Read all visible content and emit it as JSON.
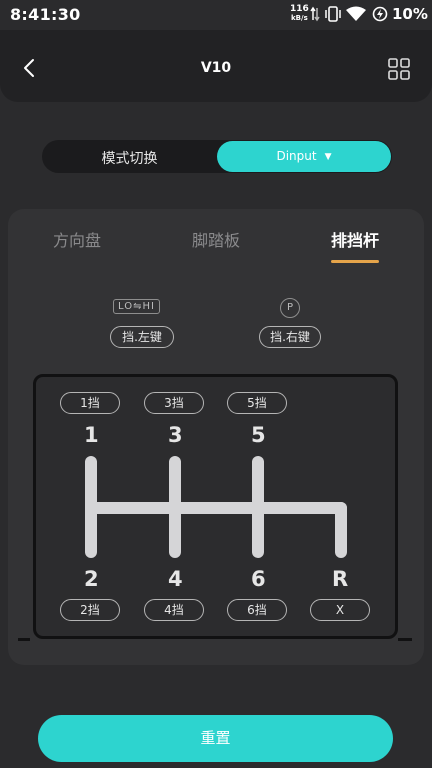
{
  "status_bar": {
    "time": "8:41:30",
    "net_speed": "116",
    "net_unit": "kB/s",
    "battery": "10%",
    "icons": [
      "upload-download-icon",
      "vibrate-icon",
      "wifi-icon",
      "battery-saver-icon"
    ]
  },
  "header": {
    "title": "V10",
    "back_icon": "chevron-left-icon",
    "menu_icon": "grid-icon"
  },
  "mode_switch": {
    "label": "模式切换",
    "selected": "Dinput",
    "chevron": "⌄"
  },
  "tabs": [
    {
      "label": "方向盘",
      "active": false
    },
    {
      "label": "脚踏板",
      "active": false
    },
    {
      "label": "排挡杆",
      "active": true
    }
  ],
  "buttons": {
    "lohi_badge": "LO⇋HI",
    "left_key": "挡.左键",
    "p_badge": "P",
    "right_key": "挡.右键"
  },
  "gears": {
    "top_pills": [
      "1挡",
      "3挡",
      "5挡"
    ],
    "top_numbers": [
      "1",
      "3",
      "5"
    ],
    "bottom_numbers": [
      "2",
      "4",
      "6",
      "R"
    ],
    "bottom_pills": [
      "2挡",
      "4挡",
      "6挡",
      "X"
    ]
  },
  "reset_label": "重置",
  "colors": {
    "accent": "#2dd4cf",
    "tab_underline": "#e5a44a",
    "background": "#2b2b2d"
  }
}
